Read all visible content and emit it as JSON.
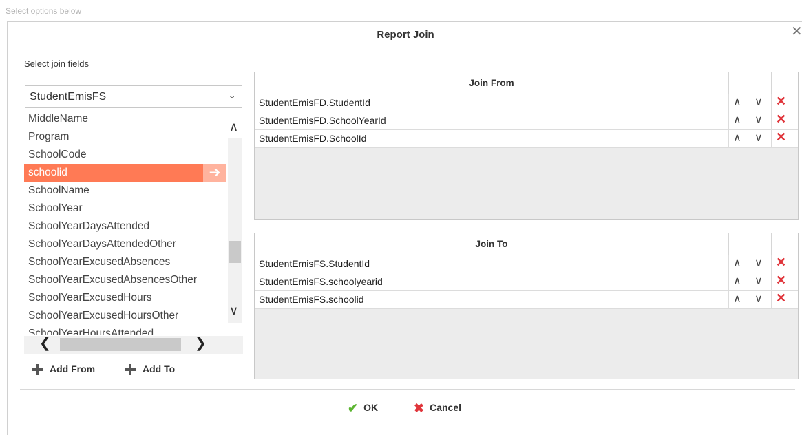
{
  "hint": "Select options below",
  "dialog": {
    "title": "Report Join",
    "section_label": "Select join fields",
    "table_select": "StudentEmisFS",
    "fields": [
      {
        "label": "MiddleName",
        "selected": false
      },
      {
        "label": "Program",
        "selected": false
      },
      {
        "label": "SchoolCode",
        "selected": false
      },
      {
        "label": "schoolid",
        "selected": true
      },
      {
        "label": "SchoolName",
        "selected": false
      },
      {
        "label": "SchoolYear",
        "selected": false
      },
      {
        "label": "SchoolYearDaysAttended",
        "selected": false
      },
      {
        "label": "SchoolYearDaysAttendedOther",
        "selected": false
      },
      {
        "label": "SchoolYearExcusedAbsences",
        "selected": false
      },
      {
        "label": "SchoolYearExcusedAbsencesOther",
        "selected": false
      },
      {
        "label": "SchoolYearExcusedHours",
        "selected": false
      },
      {
        "label": "SchoolYearExcusedHoursOther",
        "selected": false
      },
      {
        "label": "SchoolYearHoursAttended",
        "selected": false
      }
    ],
    "add_from": "Add From",
    "add_to": "Add To",
    "join_from": {
      "header": "Join From",
      "rows": [
        "StudentEmisFD.StudentId",
        "StudentEmisFD.SchoolYearId",
        "StudentEmisFD.SchoolId"
      ]
    },
    "join_to": {
      "header": "Join To",
      "rows": [
        "StudentEmisFS.StudentId",
        "StudentEmisFS.schoolyearid",
        "StudentEmisFS.schoolid"
      ]
    },
    "ok": "OK",
    "cancel": "Cancel",
    "colors": {
      "accent": "#ff7a55",
      "ok": "#5cb531",
      "delete": "#e0353b"
    }
  }
}
